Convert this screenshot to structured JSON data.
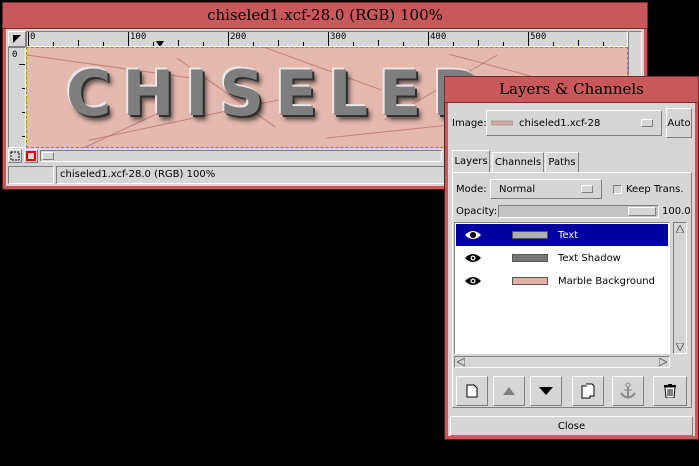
{
  "image_window": {
    "title": "chiseled1.xcf-28.0 (RGB) 100%",
    "canvas_text": "CHISELED",
    "ruler_labels": [
      "0",
      "100",
      "200",
      "300",
      "400",
      "500"
    ],
    "vruler_label": "0",
    "status_text": "chiseled1.xcf-28.0 (RGB) 100%"
  },
  "layers_dialog": {
    "title": "Layers & Channels",
    "image_label": "Image:",
    "image_value": "chiseled1.xcf-28",
    "auto_label": "Auto",
    "tabs": [
      {
        "label": "Layers"
      },
      {
        "label": "Channels"
      },
      {
        "label": "Paths"
      }
    ],
    "mode_label": "Mode:",
    "mode_value": "Normal",
    "keep_trans_label": "Keep Trans.",
    "opacity_label": "Opacity:",
    "opacity_value": "100.0",
    "opacity_fraction": 1.0,
    "layers": [
      {
        "name": "Text",
        "selected": true,
        "visible": true
      },
      {
        "name": "Text Shadow",
        "selected": false,
        "visible": true
      },
      {
        "name": "Marble Background",
        "selected": false,
        "visible": true
      }
    ],
    "close_label": "Close"
  },
  "colors": {
    "title_bar": "#c8585a",
    "panel": "#d6d6d6",
    "selection": "#0000a0",
    "canvas": "#e4b9ae"
  }
}
